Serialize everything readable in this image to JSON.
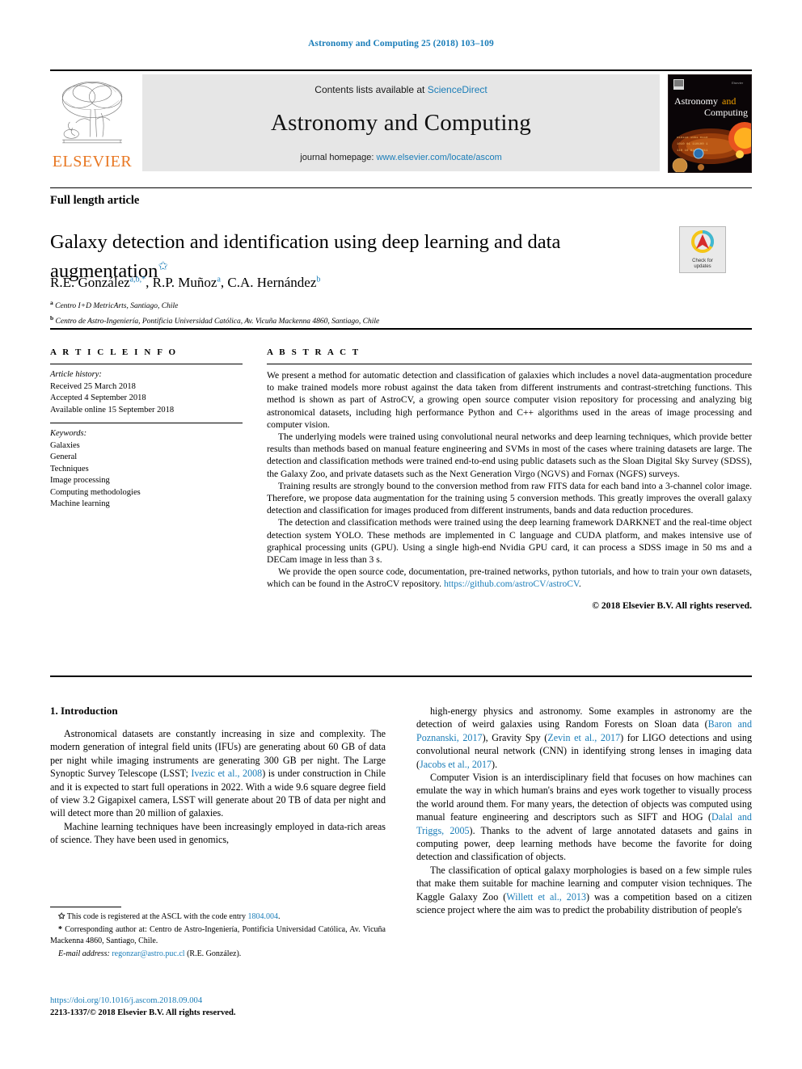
{
  "running_head": "Astronomy and Computing 25 (2018) 103–109",
  "masthead": {
    "contents_prefix": "Contents lists available at ",
    "contents_link": "ScienceDirect",
    "journal_title": "Astronomy and Computing",
    "homepage_prefix": "journal homepage: ",
    "homepage_link": "www.elsevier.com/locate/ascom",
    "publisher_logo_word": "ELSEVIER",
    "cover_title_line1": "Astronomy",
    "cover_title_and": "and",
    "cover_title_line2": "Computing"
  },
  "article_type": "Full length article",
  "title": {
    "text": "Galaxy detection and identification using deep learning and data augmentation",
    "footnote_marker": "✩"
  },
  "authors": {
    "list": [
      {
        "name": "R.E. González",
        "marks": "a,b,*"
      },
      {
        "name": "R.P. Muñoz",
        "marks": "a"
      },
      {
        "name": "C.A. Hernández",
        "marks": "b"
      }
    ]
  },
  "affiliations": [
    {
      "mark": "a",
      "text": "Centro I+D MetricArts, Santiago, Chile"
    },
    {
      "mark": "b",
      "text": "Centro de Astro-Ingeniería, Pontificia Universidad Católica, Av. Vicuña Mackenna 4860, Santiago, Chile"
    }
  ],
  "crossmark": {
    "label_line1": "Check for",
    "label_line2": "updates",
    "ring_outer_color": "#f5c518",
    "ring_inner_color": "#3fb8d4",
    "center_color": "#d62b2b"
  },
  "article_info": {
    "heading": "A R T I C L E   I N F O",
    "history_label": "Article history:",
    "history": [
      "Received 25 March 2018",
      "Accepted 4 September 2018",
      "Available online 15 September 2018"
    ],
    "keywords_label": "Keywords:",
    "keywords": [
      "Galaxies",
      "General",
      "Techniques",
      "Image processing",
      "Computing methodologies",
      "Machine learning"
    ]
  },
  "abstract": {
    "heading": "A B S T R A C T",
    "paragraphs": [
      "We present a method for automatic detection and classification of galaxies which includes a novel data-augmentation procedure to make trained models more robust against the data taken from different instruments and contrast-stretching functions. This method is shown as part of AstroCV, a growing open source computer vision repository for processing and analyzing big astronomical datasets, including high performance Python and C++ algorithms used in the areas of image processing and computer vision.",
      "The underlying models were trained using convolutional neural networks and deep learning techniques, which provide better results than methods based on manual feature engineering and SVMs in most of the cases where training datasets are large. The detection and classification methods were trained end-to-end using public datasets such as the Sloan Digital Sky Survey (SDSS), the Galaxy Zoo, and private datasets such as the Next Generation Virgo (NGVS) and Fornax (NGFS) surveys.",
      "Training results are strongly bound to the conversion method from raw FITS data for each band into a 3-channel color image. Therefore, we propose data augmentation for the training using 5 conversion methods. This greatly improves the overall galaxy detection and classification for images produced from different instruments, bands and data reduction procedures.",
      "The detection and classification methods were trained using the deep learning framework DARKNET and the real-time object detection system YOLO. These methods are implemented in C language and CUDA platform, and makes intensive use of graphical processing units (GPU). Using a single high-end Nvidia GPU card, it can process a SDSS image in 50 ms and a DECam image in less than 3 s."
    ],
    "last_paragraph_prefix": "We provide the open source code, documentation, pre-trained networks, python tutorials, and how to train your own datasets, which can be found in the AstroCV repository. ",
    "last_paragraph_link": "https://github.com/astroCV/astroCV",
    "last_paragraph_suffix": ".",
    "copyright": "© 2018 Elsevier B.V. All rights reserved."
  },
  "introduction": {
    "heading": "1. Introduction",
    "left_paragraphs": [
      {
        "parts": [
          {
            "t": "Astronomical datasets are constantly increasing in size and complexity. The modern generation of integral field units (IFUs) are generating about 60 GB of data per night while imaging instruments are generating 300 GB per night. The Large Synoptic Survey Telescope (LSST; "
          },
          {
            "t": "Ivezic et al., 2008",
            "link": true
          },
          {
            "t": ") is under construction in Chile and it is expected to start full operations in 2022. With a wide 9.6 square degree field of view 3.2 Gigapixel camera, LSST will generate about 20 TB of data per night and will detect more than 20 million of galaxies."
          }
        ]
      },
      {
        "parts": [
          {
            "t": "Machine learning techniques have been increasingly employed in data-rich areas of science. They have been used in genomics,"
          }
        ]
      }
    ],
    "right_paragraphs": [
      {
        "parts": [
          {
            "t": "high-energy physics and astronomy. Some examples in astronomy are the detection of weird galaxies using Random Forests on Sloan data ("
          },
          {
            "t": "Baron and Poznanski, 2017",
            "link": true
          },
          {
            "t": "), Gravity Spy ("
          },
          {
            "t": "Zevin et al., 2017",
            "link": true
          },
          {
            "t": ") for LIGO detections and using convolutional neural network (CNN) in identifying strong lenses in imaging data ("
          },
          {
            "t": "Jacobs et al., 2017",
            "link": true
          },
          {
            "t": ")."
          }
        ]
      },
      {
        "parts": [
          {
            "t": "Computer Vision is an interdisciplinary field that focuses on how machines can emulate the way in which human's brains and eyes work together to visually process the world around them. For many years, the detection of objects was computed using manual feature engineering and descriptors such as SIFT and HOG ("
          },
          {
            "t": "Dalal and Triggs, 2005",
            "link": true
          },
          {
            "t": "). Thanks to the advent of large annotated datasets and gains in computing power, deep learning methods have become the favorite for doing detection and classification of objects."
          }
        ]
      },
      {
        "parts": [
          {
            "t": "The classification of optical galaxy morphologies is based on a few simple rules that make them suitable for machine learning and computer vision techniques. The Kaggle Galaxy Zoo ("
          },
          {
            "t": "Willett et al., 2013",
            "link": true
          },
          {
            "t": ") was a competition based on a citizen science project where the aim was to predict the probability distribution of people's"
          }
        ]
      }
    ]
  },
  "footnotes": [
    {
      "mark": "✩",
      "parts": [
        {
          "t": " This code is registered at the ASCL with the code entry "
        },
        {
          "t": "1804.004",
          "link": true
        },
        {
          "t": "."
        }
      ]
    },
    {
      "mark": "*",
      "parts": [
        {
          "t": " Corresponding author at: Centro de Astro-Ingeniería, Pontificia Universidad Católica, Av. Vicuña Mackenna 4860, Santiago, Chile."
        }
      ]
    },
    {
      "mark": "",
      "italic_label": "E-mail address:",
      "parts": [
        {
          "t": " "
        },
        {
          "t": "regonzar@astro.puc.cl",
          "link": true
        },
        {
          "t": " (R.E. González)."
        }
      ]
    }
  ],
  "doi": "https://doi.org/10.1016/j.ascom.2018.09.004",
  "issn_line": "2213-1337/© 2018 Elsevier B.V. All rights reserved.",
  "colors": {
    "link": "#1a7db8",
    "elsevier_orange": "#e87722",
    "masthead_bg": "#e6e6e6"
  }
}
